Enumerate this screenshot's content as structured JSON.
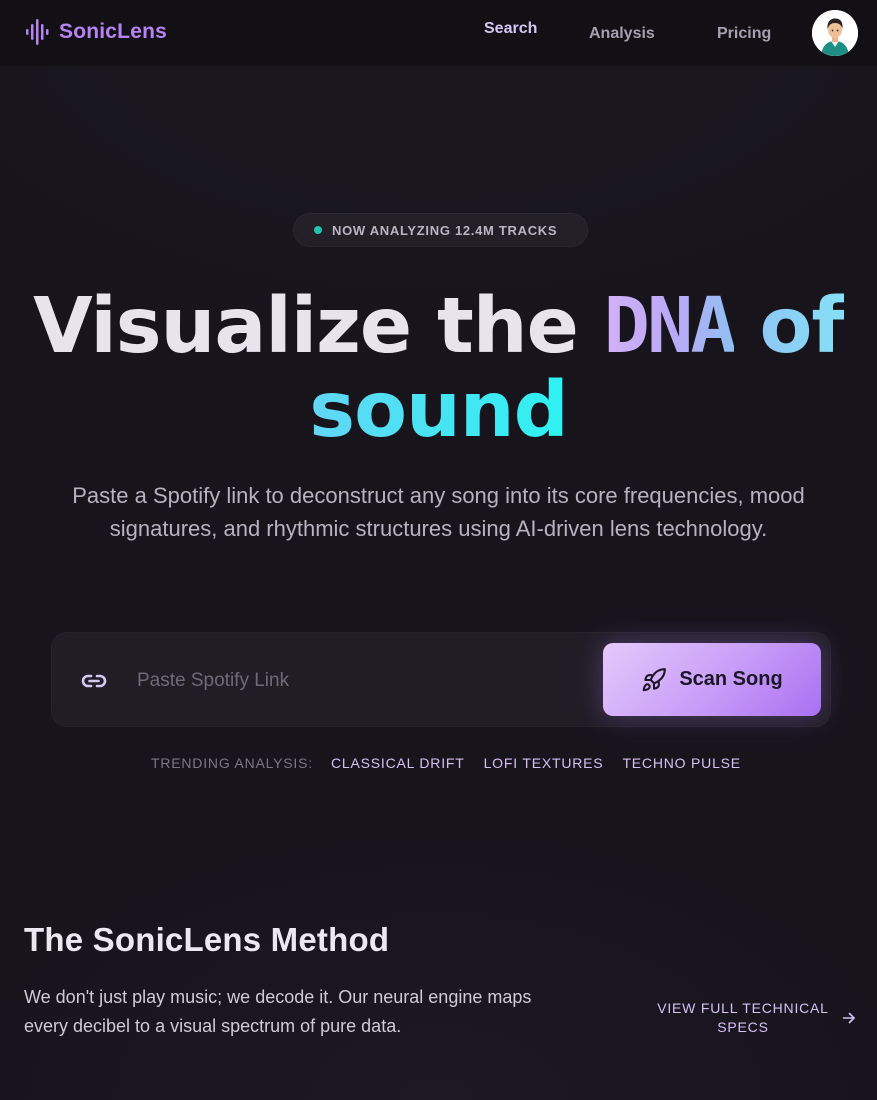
{
  "nav": {
    "brand": "SonicLens",
    "links": [
      "Search",
      "Analysis",
      "Pricing"
    ],
    "avatar_icon": "user-avatar-icon"
  },
  "hero": {
    "badge": "NOW ANALYZING 12.4M TRACKS",
    "headline": {
      "word1": "Visualize the",
      "word2": "DNA",
      "word3": "of",
      "word4": "sound"
    },
    "subtitle": "Paste a Spotify link to deconstruct any song into its core frequencies, mood signatures, and rhythmic structures using AI-driven lens technology."
  },
  "search": {
    "placeholder": "Paste Spotify Link",
    "value": "",
    "button_label": "Scan Song",
    "input_icon": "link-icon",
    "button_icon": "rocket-icon"
  },
  "trending": {
    "label": "TRENDING ANALYSIS:",
    "items": [
      "CLASSICAL DRIFT",
      "LOFI TEXTURES",
      "TECHNO PULSE"
    ]
  },
  "method": {
    "title": "The SonicLens Method",
    "description": "We don't just play music; we decode it. Our neural engine maps every decibel to a visual spectrum of pure data.",
    "specs_link": "VIEW FULL TECHNICAL SPECS"
  },
  "colors": {
    "background": "#17141c",
    "accent_purple": "#b782f4",
    "accent_cyan": "#2df2f2",
    "status_dot": "#1ec4b1"
  }
}
